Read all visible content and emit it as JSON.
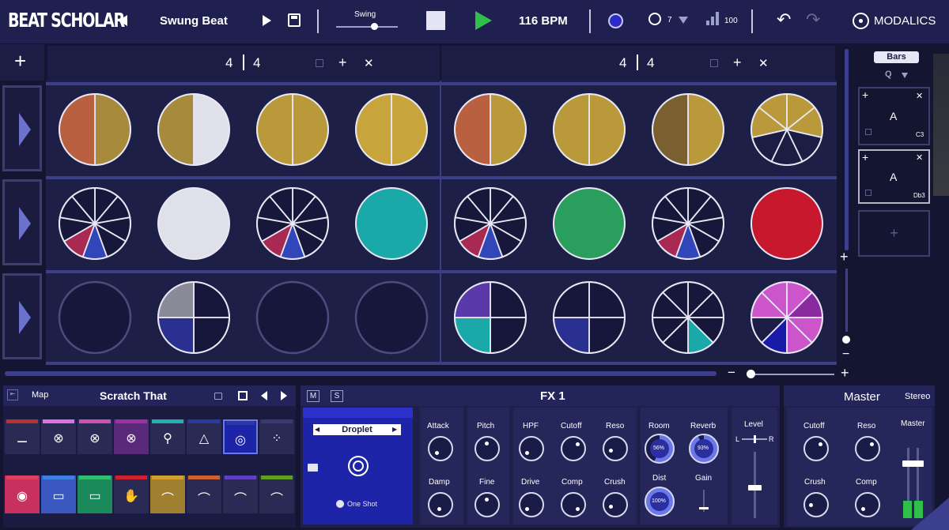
{
  "app": {
    "logo": "BEAT SCHOLAR",
    "brand": "MODALICS"
  },
  "toolbar": {
    "pattern_name": "Swung Beat",
    "swing_label": "Swing",
    "swing_value": 0.65,
    "bpm": "116 BPM",
    "quantize_value": "7",
    "velocity_value": "100"
  },
  "sequencer": {
    "add_label": "+",
    "timesig1": {
      "num": "4",
      "den": "4"
    },
    "timesig2": {
      "num": "4",
      "den": "4"
    },
    "tiles": "A",
    "note1": "C3",
    "note2": "Db3",
    "view_mode": "Bars",
    "q_label": "Q"
  },
  "bottom": {
    "map_label": "Map",
    "kit_name": "Scratch That",
    "fx": {
      "title": "FX 1",
      "m": "M",
      "s": "S",
      "preset": "Droplet",
      "one_shot": "One Shot",
      "labels": {
        "attack": "Attack",
        "pitch": "Pitch",
        "hpf": "HPF",
        "cutoff": "Cutoff",
        "reso": "Reso",
        "room": "Room",
        "reverb": "Reverb",
        "level": "Level",
        "decay": "Damp",
        "fine": "Fine",
        "drive": "Drive",
        "comp": "Comp",
        "crush": "Crush",
        "dist": "Dist",
        "gain": "Gain",
        "l": "L",
        "r": "R"
      },
      "values": {
        "room": "56%",
        "reverb": "93%",
        "dist": "100%"
      }
    },
    "master": {
      "title": "Master",
      "mode": "Stereo",
      "labels": {
        "cutoff": "Cutoff",
        "reso": "Reso",
        "crush": "Crush",
        "comp": "Comp",
        "master": "Master"
      }
    }
  },
  "colors": {
    "accent": "#2b2cc8",
    "play": "#2fbf4a",
    "gold": "#b9993a",
    "teal": "#1aa8a8",
    "green": "#2a9e5c",
    "red": "#c8182e",
    "blue": "#3146b8",
    "crimson": "#a82a52",
    "magenta": "#cc55cc"
  }
}
